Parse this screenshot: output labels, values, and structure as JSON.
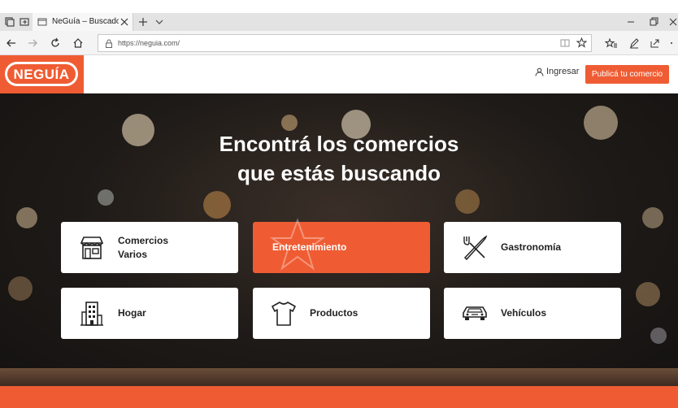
{
  "browser": {
    "tab_title": "NeGuía – Buscador de c",
    "url": "https://neguia.com/"
  },
  "header": {
    "logo_text": "NEGUÍA",
    "login_label": "Ingresar",
    "publish_label": "Publicá tu comercio"
  },
  "hero": {
    "title_line1": "Encontrá los comercios",
    "title_line2": "que estás buscando"
  },
  "categories": [
    {
      "label_line1": "Comercios",
      "label_line2": "Varios",
      "icon": "store-icon"
    },
    {
      "label_line1": "Entretenimiento",
      "label_line2": "",
      "icon": "star-icon"
    },
    {
      "label_line1": "Gastronomía",
      "label_line2": "",
      "icon": "fork-knife-icon"
    },
    {
      "label_line1": "Hogar",
      "label_line2": "",
      "icon": "building-icon"
    },
    {
      "label_line1": "Productos",
      "label_line2": "",
      "icon": "tshirt-icon"
    },
    {
      "label_line1": "Vehículos",
      "label_line2": "",
      "icon": "car-icon"
    }
  ],
  "colors": {
    "brand": "#ef5c33",
    "hero_dark": "#1e1a17"
  }
}
